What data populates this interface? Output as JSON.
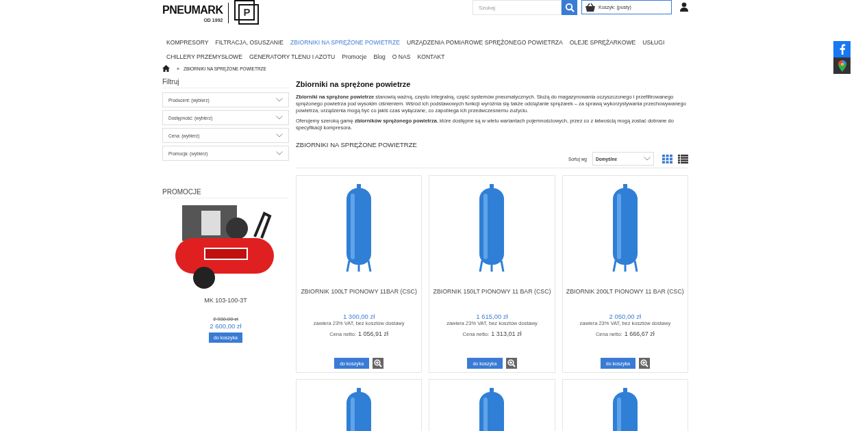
{
  "logo": {
    "name": "PNEUMARK",
    "since": "OD 1992",
    "mark": "P"
  },
  "search": {
    "placeholder": "Szukaj"
  },
  "cart": {
    "label": "Koszyk: (pusty)"
  },
  "menu": [
    {
      "label": "KOMPRESORY",
      "selected": false
    },
    {
      "label": "FILTRACJA, OSUSZANIE",
      "selected": false
    },
    {
      "label": "ZBIORNIKI NA SPRĘŻONE POWIETRZE",
      "selected": true
    },
    {
      "label": "URZĄDZENIA POMIAROWE SPRĘŻONEGO POWIETRZA",
      "selected": false
    },
    {
      "label": "OLEJE SPRĘŻARKOWE",
      "selected": false
    },
    {
      "label": "USŁUGI",
      "selected": false
    },
    {
      "label": "CHILLERY PRZEMYSŁOWE",
      "selected": false
    },
    {
      "label": "GENERATORY TLENU I AZOTU",
      "selected": false
    },
    {
      "label": "Promocje",
      "selected": false
    },
    {
      "label": "Blog",
      "selected": false
    },
    {
      "label": "O NAS",
      "selected": false
    },
    {
      "label": "KONTAKT",
      "selected": false
    }
  ],
  "breadcrumb": {
    "separator": "»",
    "current": "ZBIORNIKI NA SPRĘŻONE POWIETRZE"
  },
  "sidebar": {
    "filter_title": "Filtruj",
    "filters": [
      "Producent: (wybierz)",
      "Dostępność: (wybierz)",
      "Cena: (wybierz)",
      "Promocja: (wybierz)"
    ],
    "promo_title": "PROMOCJE",
    "promo": {
      "name": "MK 103-100-3T",
      "old_price": "2 930,00 zł",
      "price": "2 600,00 zł",
      "button": "do koszyka"
    }
  },
  "category": {
    "title": "Zbiorniki na sprężone powietrze",
    "paragraphs": [
      "**Zbiorniki na sprężone powietrze** stanowią ważną, często integralną, część systemów pneumatycznych. Służą do magazynowania oczyszczonego i przefiltrowanego sprężonego powietrza pod wysokim ciśnieniem. Wśród ich podstawowych funkcji wyróżnia się także odciążanie sprężarek – za sprawą wykorzystywania przechowywanego powietrza, urządzenia mogą być co jakiś czas wyłączane, co zapobiega ich przedwczesnemu zużyciu.",
      "Oferujemy szeroką gamę **zbiorników sprężonego powietrza**, które dostępne są w wielu wariantach pojemnościowych, przez co z łatwością mogą zostać dobrane do specyfikacji kompresora."
    ],
    "listing_title": "ZBIORNIKI NA SPRĘŻONE POWIETRZE",
    "sort_label": "Sortuj wg",
    "sort_value": "Domyślne",
    "view_modes": [
      {
        "kind": "grid",
        "selected": true
      },
      {
        "kind": "list",
        "selected": false
      }
    ]
  },
  "products": [
    {
      "kind": "full",
      "name": "ZBIORNIK 100LT PIONOWY 11BAR (CSC)",
      "price": "1 300,00 zł",
      "vat_note": "zawiera 23% VAT, bez kosztów dostawy",
      "net_label": "Cena netto:",
      "net_price": "1 056,91 zł",
      "button": "do koszyka"
    },
    {
      "kind": "full",
      "name": "ZBIORNIK 150LT PIONOWY 11 BAR (CSC)",
      "price": "1 615,00 zł",
      "vat_note": "zawiera 23% VAT, bez kosztów dostawy",
      "net_label": "Cena netto:",
      "net_price": "1 313,01 zł",
      "button": "do koszyka"
    },
    {
      "kind": "full",
      "name": "ZBIORNIK 200LT PIONOWY 11 BAR (CSC)",
      "price": "2 050,00 zł",
      "vat_note": "zawiera 23% VAT, bez kosztów dostawy",
      "net_label": "Cena netto:",
      "net_price": "1 666,67 zł",
      "button": "do koszyka"
    },
    {
      "kind": "cut"
    },
    {
      "kind": "cut"
    },
    {
      "kind": "cut"
    }
  ]
}
